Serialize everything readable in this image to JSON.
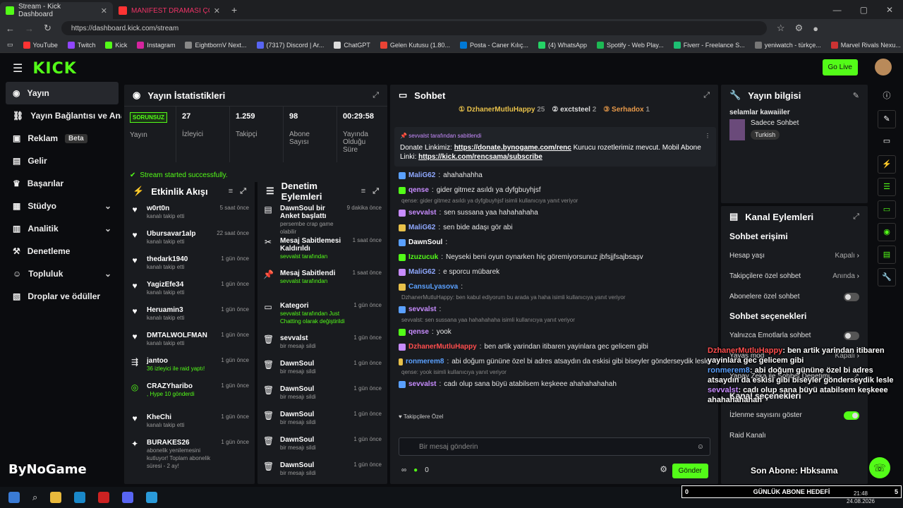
{
  "browser": {
    "tabs": [
      {
        "label": "Stream - Kick Dashboard"
      },
      {
        "label": "MANIFEST DRAMASI ÇOK FENA!"
      }
    ],
    "url": "https://dashboard.kick.com/stream",
    "bookmarks": [
      "YouTube",
      "Twitch",
      "Kick",
      "Instagram",
      "EightbornV Next...",
      "(7317) Discord | Ar...",
      "ChatGPT",
      "Gelen Kutusu (1.80...",
      "Posta - Caner Kılıç...",
      "(4) WhatsApp",
      "Spotify - Web Play...",
      "Fiverr - Freelance S...",
      "yeniwatch - türkçe...",
      "Marvel Rivals Nexu..."
    ]
  },
  "header": {
    "logo": "KICK",
    "go_live": "Go Live"
  },
  "sidebar": {
    "items": [
      {
        "label": "Yayın"
      },
      {
        "label": "Yayın Bağlantısı ve Anahtarı"
      },
      {
        "label": "Reklam",
        "badge": "Beta"
      },
      {
        "label": "Gelir"
      },
      {
        "label": "Başarılar"
      },
      {
        "label": "Stüdyo"
      },
      {
        "label": "Analitik"
      },
      {
        "label": "Denetleme"
      },
      {
        "label": "Topluluk"
      },
      {
        "label": "Droplar ve ödüller"
      }
    ],
    "brand": "ByNoGame"
  },
  "stats": {
    "title": "Yayın İstatistikleri",
    "status": "SORUNSUZ",
    "status_label": "Yayın",
    "items": [
      {
        "value": "27",
        "label": "İzleyici"
      },
      {
        "value": "1.259",
        "label": "Takipçi"
      },
      {
        "value": "98",
        "label": "Abone Sayısı"
      },
      {
        "value": "00:29:58",
        "label": "Yayında Olduğu Süre"
      }
    ],
    "success": "Stream started successfully."
  },
  "activity": {
    "title": "Etkinlik Akışı",
    "items": [
      {
        "name": "w0rt0n",
        "sub": "kanalı takip etti",
        "time": "5 saat önce"
      },
      {
        "name": "Ubursavar1alp",
        "sub": "kanalı takip etti",
        "time": "22 saat önce"
      },
      {
        "name": "thedark1940",
        "sub": "kanalı takip etti",
        "time": "1 gün önce"
      },
      {
        "name": "YagizEfe34",
        "sub": "kanalı takip etti",
        "time": "1 gün önce"
      },
      {
        "name": "Heruamin3",
        "sub": "kanalı takip etti",
        "time": "1 gün önce"
      },
      {
        "name": "DMTALWOLFMAN",
        "sub": "kanalı takip etti",
        "time": "1 gün önce"
      },
      {
        "name": "jantoo",
        "sub": "36 izleyici ile raid yaptı!",
        "time": "1 gün önce"
      },
      {
        "name": "CRAZYharibo",
        "sub": ", Hype 10 gönderdi",
        "time": "1 gün önce"
      },
      {
        "name": "KheChi",
        "sub": "kanalı takip etti",
        "time": "1 gün önce"
      },
      {
        "name": "BURAKES26",
        "sub": "abonelik yenilemesini kutluyor! Toplam abonelik süresi - 2 ay!",
        "time": "1 gün önce"
      }
    ]
  },
  "moderation": {
    "title": "Denetim Eylemleri",
    "items": [
      {
        "name": "DawnSoul bir Anket başlattı",
        "sub": "persembe crap game olabilir",
        "time": "9 dakika önce"
      },
      {
        "name": "Mesaj Sabitlemesi Kaldırıldı",
        "sub": "sevvalst tarafından",
        "time": "1 saat önce"
      },
      {
        "name": "Mesaj Sabitlendi",
        "sub": "sevvalst tarafından",
        "time": "1 saat önce"
      },
      {
        "name": "Kategori",
        "sub": "sevvalst tarafından Just Chatting olarak değiştirildi",
        "time": "1 gün önce"
      },
      {
        "name": "sevvalst",
        "sub": "bir mesajı sildi",
        "time": "1 gün önce"
      },
      {
        "name": "DawnSoul",
        "sub": "bir mesajı sildi",
        "time": "1 gün önce"
      },
      {
        "name": "DawnSoul",
        "sub": "bir mesajı sildi",
        "time": "1 gün önce"
      },
      {
        "name": "DawnSoul",
        "sub": "bir mesajı sildi",
        "time": "1 gün önce"
      },
      {
        "name": "DawnSoul",
        "sub": "bir mesajı sildi",
        "time": "1 gün önce"
      },
      {
        "name": "DawnSoul",
        "sub": "bir mesajı sildi",
        "time": "1 gün önce"
      }
    ]
  },
  "chat": {
    "title": "Sohbet",
    "top": [
      {
        "name": "DzhanerMutluHappy",
        "n": "25"
      },
      {
        "name": "exctsteel",
        "n": "2"
      },
      {
        "name": "Serhadox",
        "n": "1"
      }
    ],
    "pinned_by": "sevvalst tarafından sabitlendi",
    "pinned_text": "Donate Linkimiz: ",
    "pinned_link1": "https://donate.bynogame.com/renc",
    "pinned_mid": " Kurucu rozetlerimiz mevcut. Mobil Abone Linki: ",
    "pinned_link2": "https://kick.com/rencsama/subscribe",
    "messages": [
      {
        "user": "MaliG62",
        "color": "#8fa8ff",
        "text": "ahahahahha"
      },
      {
        "user": "qense",
        "color": "#c88cff",
        "text": "gider gitmez asıldı ya dyfgbuyhjsf"
      },
      {
        "reply": "qense: gider gitmez asıldı ya dyfgbuyhjsf isimli kullanıcıya yanıt veriyor",
        "user": "sevvalst",
        "color": "#c88cff",
        "text": "sen sussana yaa hahahahaha"
      },
      {
        "user": "MaliG62",
        "color": "#8fa8ff",
        "text": "sen bide adaşı gör abi"
      },
      {
        "user": "DawnSoul",
        "color": "#ffffff",
        "text": ""
      },
      {
        "user": "Izuzucuk",
        "color": "#53fc18",
        "text": "Neyseki beni oyun oynarken hiç göremiyorsunuz jbfsjjfsajbsaşv"
      },
      {
        "user": "MaliG62",
        "color": "#8fa8ff",
        "text": "e sporcu mübarek"
      },
      {
        "user": "CansuLyasova",
        "color": "#5aa0ff",
        "text": ""
      },
      {
        "reply": "DzhanerMutluHappy: ben kabul ediyorum bu arada ya haha isimli kullanıcıya yanıt veriyor",
        "user": "sevvalst",
        "color": "#c88cff",
        "text": ""
      },
      {
        "reply": "sevvalst: sen sussana yaa hahahahaha isimli kullanıcıya yanıt veriyor",
        "user": "qense",
        "color": "#c88cff",
        "text": "yook"
      },
      {
        "user": "DzhanerMutluHappy",
        "color": "#ff4d4d",
        "text": "ben artik yarindan itibaren yayinlara gec gelicem gibi"
      },
      {
        "user": "ronmerem8",
        "color": "#5aa0ff",
        "text": "abi doğum gününe özel bi adres atsaydın da eskisi gibi biseyler gönderseydik lesle"
      },
      {
        "reply": "qense: yook isimli kullanıcıya yanıt veriyor",
        "user": "sevvalst",
        "color": "#c88cff",
        "text": "cadı olup sana büyü atabilsem keşkeee ahahahahahah"
      }
    ],
    "followers_label": "Takipçilere Özel",
    "input_placeholder": "Bir mesaj gönderin",
    "counter": "0",
    "send": "Gönder"
  },
  "info": {
    "title": "Yayın bilgisi",
    "stream_title": "selamlar kawaiiler",
    "category": "Sadece Sohbet",
    "tag": "Turkish"
  },
  "channel": {
    "title": "Kanal Eylemleri",
    "chat_access": "Sohbet erişimi",
    "rows": [
      {
        "label": "Hesap yaşı",
        "value": "Kapalı"
      },
      {
        "label": "Takipçilere özel sohbet",
        "value": "Anında"
      },
      {
        "label": "Abonelere özel sohbet",
        "value": ""
      }
    ],
    "chat_options": "Sohbet seçenekleri",
    "opt_rows": [
      {
        "label": "Yalnızca Emotlarla sohbet"
      },
      {
        "label": "Yavaş mod",
        "value": "Kapalı"
      },
      {
        "label": "Yapay Zeka ile Sohbet Denetimi"
      }
    ],
    "channel_options": "Kanal seçenekleri",
    "ch_rows": [
      {
        "label": "İzlenme sayısını göster"
      },
      {
        "label": "Raid Kanalı"
      }
    ]
  },
  "overlay": {
    "lines": [
      {
        "user": "DzhanerMutluHappy",
        "text": ": ben artik yarindan itibaren yayinlara gec gelicem gibi"
      },
      {
        "user": "ronmerem8",
        "text": ": abi doğum gününe özel bi adres atsaydın da eskisi gibi biseyler gönderseydik lesle"
      },
      {
        "user": "sevvalst",
        "text": ": cadı olup sana büyü atabilsem keşkeee ahahahahahah"
      }
    ],
    "last_sub": "Son Abone: Hbksama",
    "goal_left": "0",
    "goal_label": "GÜNLÜK ABONE HEDEFİ",
    "goal_right": "5"
  },
  "clock": {
    "time": "21:48",
    "date": "24.08.2026"
  }
}
